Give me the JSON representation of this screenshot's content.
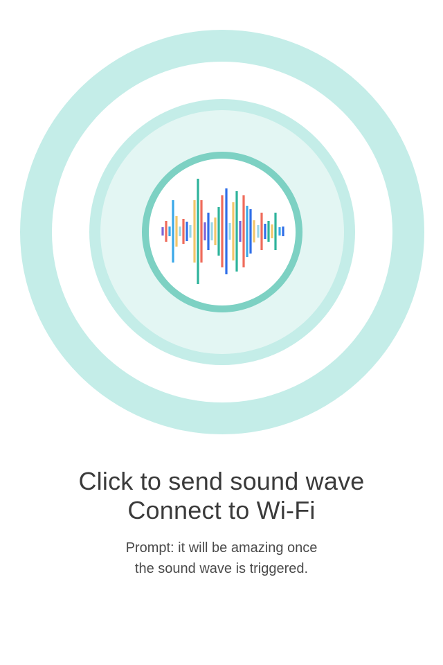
{
  "title": {
    "line1": "Click to send sound wave",
    "line2": "Connect to Wi-Fi"
  },
  "prompt": {
    "line1": "Prompt: it will be amazing once",
    "line2": "the sound wave is triggered."
  },
  "colors": {
    "ring_light": "#c4ede8",
    "ring_fill": "#e3f6f3",
    "ring_accent": "#7dd1c3",
    "text": "#3a3a3a",
    "bar_palette": [
      "#7a64d6",
      "#ef6b5b",
      "#3aa8e8",
      "#f2c66b",
      "#2f6ee8",
      "#2db39b",
      "#9ad7e8"
    ]
  },
  "icons": {
    "center": "sound-wave-icon"
  }
}
